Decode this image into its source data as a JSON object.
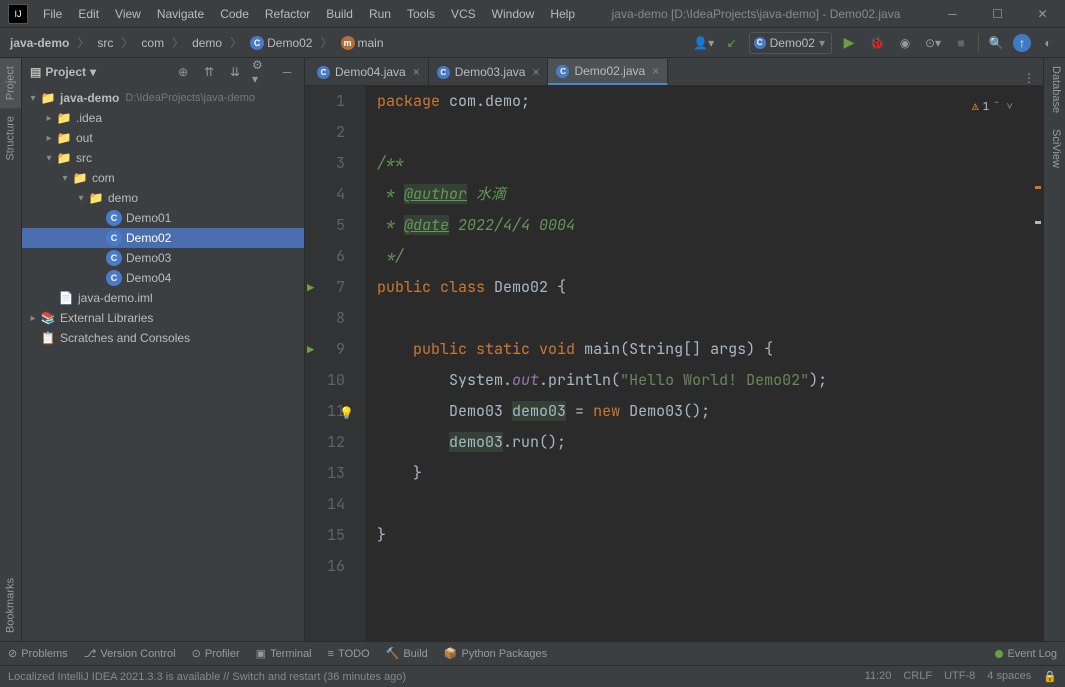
{
  "title": "java-demo [D:\\IdeaProjects\\java-demo] - Demo02.java",
  "menu": [
    "File",
    "Edit",
    "View",
    "Navigate",
    "Code",
    "Refactor",
    "Build",
    "Run",
    "Tools",
    "VCS",
    "Window",
    "Help"
  ],
  "breadcrumb": {
    "project": "java-demo",
    "src": "src",
    "com": "com",
    "demo": "demo",
    "class": "Demo02",
    "method": "main"
  },
  "runConfig": "Demo02",
  "panelTitle": "Project",
  "tree": {
    "project": "java-demo",
    "projectPath": "D:\\IdeaProjects\\java-demo",
    "idea": ".idea",
    "out": "out",
    "src": "src",
    "com": "com",
    "demo": "demo",
    "d1": "Demo01",
    "d2": "Demo02",
    "d3": "Demo03",
    "d4": "Demo04",
    "iml": "java-demo.iml",
    "ext": "External Libraries",
    "scratch": "Scratches and Consoles"
  },
  "tabs": {
    "t1": "Demo04.java",
    "t2": "Demo03.java",
    "t3": "Demo02.java"
  },
  "lines": [
    "1",
    "2",
    "3",
    "4",
    "5",
    "6",
    "7",
    "8",
    "9",
    "10",
    "11",
    "12",
    "13",
    "14",
    "15",
    "16"
  ],
  "code": {
    "pkg_kw": "package ",
    "pkg_val": "com.demo",
    "doc_open": "/**",
    "doc_star": " * ",
    "doc_close": " */",
    "author_tag": "@author",
    "author_val": " 水滴",
    "date_tag": "@date",
    "date_val": " 2022/4/4 0004",
    "pub": "public ",
    "cls": "class ",
    "name": "Demo02",
    " lb": " {",
    "static": "static ",
    "void": "void ",
    "main": "main",
    "args": "(String[] args) {",
    "sys": "System.",
    "out": "out",
    "println": ".println(",
    "hello": "\"Hello World! Demo02\"",
    "close": ");",
    "d3type": "Demo03 ",
    "d3var": "demo03",
    " eq": " = ",
    "new": "new ",
    "d3ctor": "Demo03();",
    "run": ".run();",
    "rb": "}"
  },
  "warn": "1",
  "sideLeft": {
    "project": "Project",
    "structure": "Structure",
    "bookmarks": "Bookmarks"
  },
  "sideRight": {
    "db": "Database",
    "sci": "SciView"
  },
  "bottom": {
    "problems": "Problems",
    "vcs": "Version Control",
    "profiler": "Profiler",
    "terminal": "Terminal",
    "todo": "TODO",
    "build": "Build",
    "python": "Python Packages",
    "event": "Event Log"
  },
  "status": {
    "msg": "Localized IntelliJ IDEA 2021.3.3 is available // Switch and restart (36 minutes ago)",
    "time": "11:20",
    "le": "CRLF",
    "enc": "UTF-8",
    "ind": "4 spaces"
  }
}
